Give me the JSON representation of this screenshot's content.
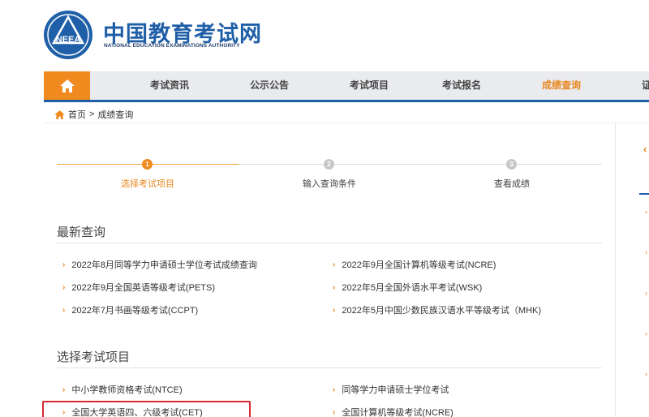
{
  "header": {
    "logo_cn": "中国教育考试网",
    "logo_en": "NATIONAL EDUCATION EXAMINATIONS AUTHORITY",
    "badge_text": "NEEA",
    "brand_color": "#1f5fa8"
  },
  "nav": {
    "home_icon": "home-icon",
    "items": [
      {
        "label": "考试资讯"
      },
      {
        "label": "公示公告"
      },
      {
        "label": "考试项目"
      },
      {
        "label": "考试报名"
      },
      {
        "label": "成绩查询"
      },
      {
        "label": "证"
      }
    ],
    "active_index": 4,
    "accent_color": "#f08a1e"
  },
  "breadcrumb": {
    "home": "首页",
    "separator": ">",
    "current": "成绩查询"
  },
  "steps": [
    {
      "number": "1",
      "label": "选择考试项目",
      "active": true
    },
    {
      "number": "2",
      "label": "输入查询条件",
      "active": false
    },
    {
      "number": "3",
      "label": "查看成绩",
      "active": false
    }
  ],
  "latest": {
    "title": "最新查询",
    "left": [
      "2022年8月同等学力申请硕士学位考试成绩查询",
      "2022年9月全国英语等级考试(PETS)",
      "2022年7月书画等级考试(CCPT)"
    ],
    "right": [
      "2022年9月全国计算机等级考试(NCRE)",
      "2022年5月全国外语水平考试(WSK)",
      "2022年5月中国少数民族汉语水平等级考试（MHK)"
    ]
  },
  "projects": {
    "title": "选择考试项目",
    "left": [
      "中小学教师资格考试(NTCE)",
      "全国大学英语四、六级考试(CET)"
    ],
    "right": [
      "同等学力申请硕士学位考试",
      "全国计算机等级考试(NCRE)"
    ]
  },
  "arrow_glyph": "›",
  "sidebar": {
    "chevron": "‹"
  }
}
